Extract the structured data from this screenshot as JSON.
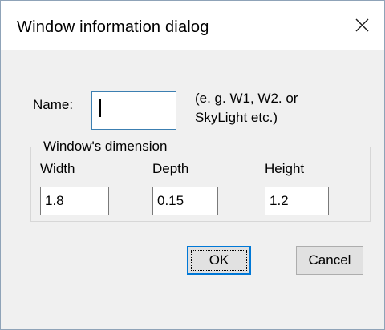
{
  "window": {
    "title": "Window information dialog",
    "close_icon": "close-x-icon"
  },
  "name_row": {
    "label": "Name:",
    "value": "",
    "hint_line1": "(e. g. W1, W2. or",
    "hint_line2": "SkyLight etc.)"
  },
  "dimension_group": {
    "title": "Window's dimension",
    "width_label": "Width",
    "depth_label": "Depth",
    "height_label": "Height",
    "width_value": "1.8",
    "depth_value": "0.15",
    "height_value": "1.2"
  },
  "buttons": {
    "ok_label": "OK",
    "cancel_label": "Cancel"
  },
  "colors": {
    "dialog_bg": "#f0f0f0",
    "titlebar_bg": "#ffffff",
    "focus_accent": "#0078d7"
  }
}
